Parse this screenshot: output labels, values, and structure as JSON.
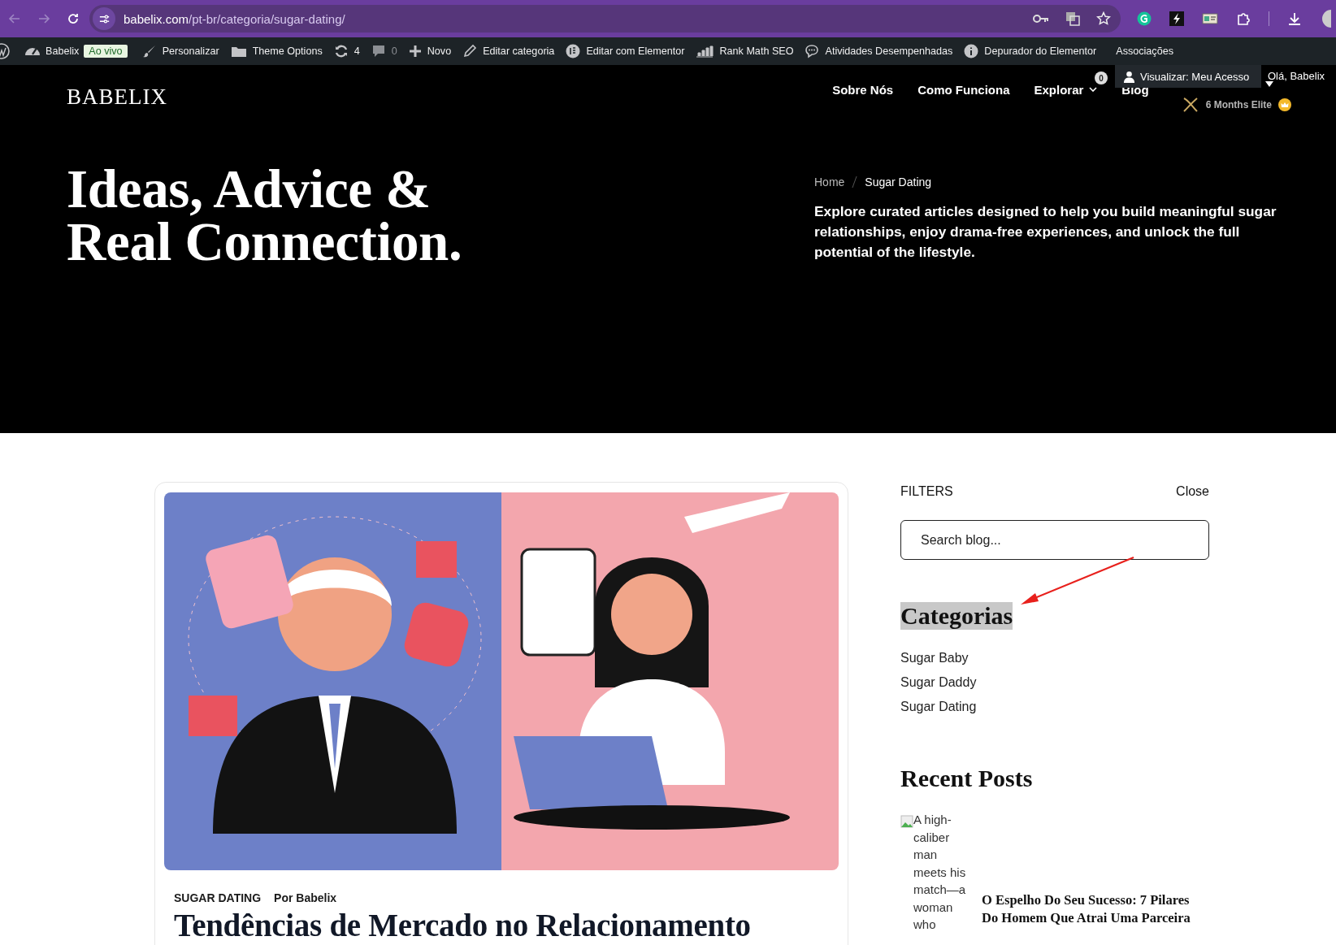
{
  "browser": {
    "url_host": "babelix.com",
    "url_path": "/pt-br/categoria/sugar-dating/"
  },
  "admin_bar": [
    {
      "kind": "logo",
      "dimmed": false
    },
    {
      "kind": "item",
      "label": "Babelix",
      "badge": "Ao vivo",
      "dimmed": false
    },
    {
      "kind": "item",
      "label": "Personalizar",
      "dimmed": false
    },
    {
      "kind": "item",
      "label": "Theme Options",
      "dimmed": false
    },
    {
      "kind": "item",
      "label": "4",
      "dimmed": false
    },
    {
      "kind": "item",
      "label": "0",
      "dimmed": true
    },
    {
      "kind": "item",
      "label": "Novo",
      "dimmed": false
    },
    {
      "kind": "item",
      "label": "Editar categoria",
      "dimmed": false
    },
    {
      "kind": "item",
      "label": "Editar com Elementor",
      "dimmed": false
    },
    {
      "kind": "item",
      "label": "Rank Math SEO",
      "dimmed": false
    },
    {
      "kind": "item",
      "label": "Atividades Desempenhadas",
      "dimmed": false
    },
    {
      "kind": "item",
      "label": "Depurador do Elementor",
      "dimmed": false
    },
    {
      "kind": "item",
      "label": "Associações",
      "dimmed": false
    }
  ],
  "header": {
    "logo": "BABELIX",
    "nav": [
      {
        "label": "Sobre Nós",
        "dropdown": false
      },
      {
        "label": "Como Funciona",
        "dropdown": false
      },
      {
        "label": "Explorar",
        "dropdown": true
      },
      {
        "label": "Blog",
        "dropdown": false
      }
    ],
    "cart_count": "0",
    "account_menu": "Visualizar: Meu Acesso",
    "greeting": "Olá, Babelix",
    "membership": "6 Months Elite"
  },
  "hero": {
    "title_lines": [
      "Ideas, Advice &",
      "Real Connection."
    ],
    "breadcrumb": [
      "Home",
      "Sugar Dating"
    ],
    "description": "Explore curated articles designed to help you build meaningful sugar relationships, enjoy drama-free experiences, and unlock the full potential of the lifestyle."
  },
  "post": {
    "category": "SUGAR DATING",
    "author": "Por Babelix",
    "title": "Tendências de Mercado no Relacionamento"
  },
  "sidebar": {
    "filters_label": "FILTERS",
    "close": "Close",
    "search": {
      "placeholder": "Search blog..."
    },
    "categories": {
      "title": "Categorias",
      "highlighted": true,
      "items": [
        "Sugar Baby",
        "Sugar Daddy",
        "Sugar Dating"
      ]
    },
    "recent_posts": {
      "title": "Recent Posts",
      "posts": [
        {
          "image_alt": "A high-caliber man meets his match—a woman who",
          "title": "O Espelho Do Seu Sucesso: 7 Pilares Do Homem Que Atrai Uma Parceira"
        }
      ]
    }
  },
  "annotation": {
    "kind": "arrow"
  }
}
